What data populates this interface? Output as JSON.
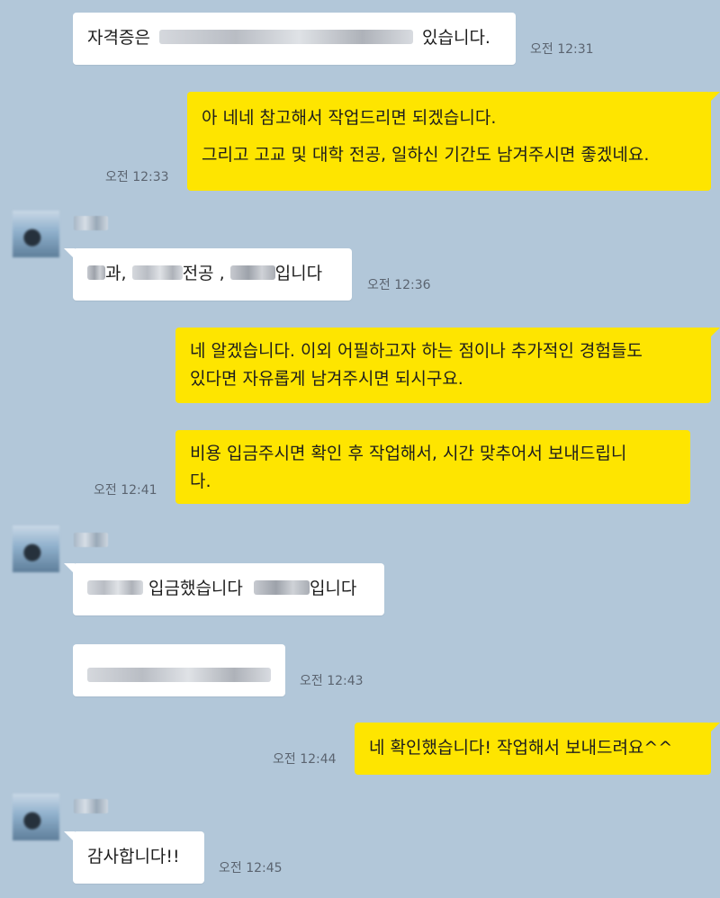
{
  "colors": {
    "background": "#b2c7d9",
    "outgoing_bubble": "#fee500",
    "incoming_bubble": "#ffffff",
    "timestamp_text": "#5b6470"
  },
  "messages": [
    {
      "direction": "incoming",
      "text_before": "자격증은",
      "text_after": "있습니다.",
      "time": "오전 12:31"
    },
    {
      "direction": "outgoing",
      "line1": "아 네네 참고해서 작업드리면 되겠습니다.",
      "line2": "그리고 고교 및 대학 전공, 일하신 기간도 남겨주시면 좋겠네요.",
      "time": "오전 12:33"
    },
    {
      "direction": "incoming",
      "part1": "과,",
      "part2": "전공 ,",
      "part3": "입니다",
      "time": "오전 12:36"
    },
    {
      "direction": "outgoing",
      "line1": "네 알겠습니다. 이외 어필하고자 하는 점이나 추가적인 경험들도",
      "line2": "있다면 자유롭게 남겨주시면 되시구요."
    },
    {
      "direction": "outgoing",
      "line1": "비용 입금주시면 확인 후 작업해서, 시간 맞추어서 보내드립니",
      "line2": "다.",
      "time": "오전 12:41"
    },
    {
      "direction": "incoming",
      "part1": "입금했습니다",
      "part2": "입니다"
    },
    {
      "direction": "incoming",
      "time": "오전 12:43"
    },
    {
      "direction": "outgoing",
      "text": "네 확인했습니다! 작업해서 보내드려요^^",
      "time": "오전 12:44"
    },
    {
      "direction": "incoming",
      "text": "감사합니다!!",
      "time": "오전 12:45"
    }
  ]
}
